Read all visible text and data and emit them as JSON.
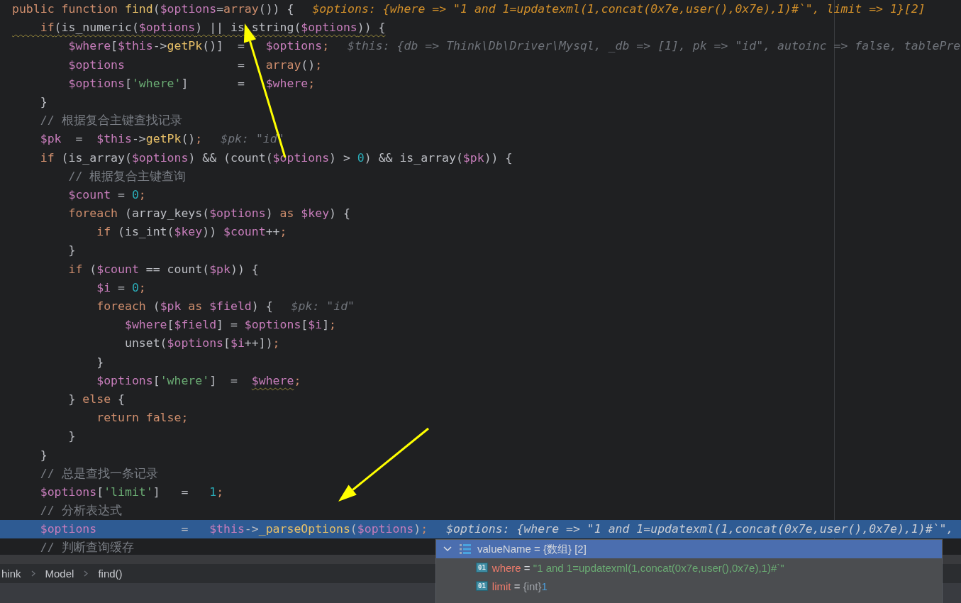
{
  "editor": {
    "lines": [
      {
        "selected": false,
        "tokens": [
          {
            "kind": "kw",
            "text": "public function "
          },
          {
            "kind": "fn",
            "text": "find"
          },
          {
            "kind": "plain",
            "text": "("
          },
          {
            "kind": "var",
            "text": "$options"
          },
          {
            "kind": "plain",
            "text": "="
          },
          {
            "kind": "kw",
            "text": "array"
          },
          {
            "kind": "plain",
            "text": "()) {"
          }
        ],
        "hint": {
          "kind": "changed",
          "text": "$options: {where => \"1 and 1=updatexml(1,concat(0x7e,user(),0x7e),1)#`\", limit => 1}[2]"
        }
      },
      {
        "selected": false,
        "tokens": [
          {
            "kind": "kw",
            "text": "    if",
            "squiggle": true
          },
          {
            "kind": "plain",
            "text": "(is_numeric(",
            "squiggle": true
          },
          {
            "kind": "var",
            "text": "$options",
            "squiggle": true
          },
          {
            "kind": "plain",
            "text": ") || is_string(",
            "squiggle": true
          },
          {
            "kind": "var",
            "text": "$options",
            "squiggle": true
          },
          {
            "kind": "plain",
            "text": ")) {",
            "squiggle": true
          }
        ]
      },
      {
        "selected": false,
        "tokens": [
          {
            "kind": "var",
            "text": "        $where"
          },
          {
            "kind": "plain",
            "text": "["
          },
          {
            "kind": "var",
            "text": "$this"
          },
          {
            "kind": "plain",
            "text": "->"
          },
          {
            "kind": "fn",
            "text": "getPk"
          },
          {
            "kind": "plain",
            "text": "()]  =   "
          },
          {
            "kind": "var",
            "text": "$options"
          },
          {
            "kind": "kw",
            "text": ";"
          }
        ],
        "hint": {
          "kind": "normal",
          "text": "$this: {db => Think\\Db\\Driver\\Mysql, _db => [1], pk => \"id\", autoinc => false, tablePre"
        }
      },
      {
        "selected": false,
        "tokens": [
          {
            "kind": "var",
            "text": "        $options"
          },
          {
            "kind": "plain",
            "text": "                =   "
          },
          {
            "kind": "kw",
            "text": "array"
          },
          {
            "kind": "plain",
            "text": "()"
          },
          {
            "kind": "kw",
            "text": ";"
          }
        ]
      },
      {
        "selected": false,
        "tokens": [
          {
            "kind": "var",
            "text": "        $options"
          },
          {
            "kind": "plain",
            "text": "["
          },
          {
            "kind": "str",
            "text": "'where'"
          },
          {
            "kind": "plain",
            "text": "]       =   "
          },
          {
            "kind": "var",
            "text": "$where"
          },
          {
            "kind": "kw",
            "text": ";"
          }
        ]
      },
      {
        "selected": false,
        "tokens": [
          {
            "kind": "plain",
            "text": "    }"
          }
        ]
      },
      {
        "selected": false,
        "tokens": [
          {
            "kind": "cmt",
            "text": "    // 根据复合主键查找记录"
          }
        ]
      },
      {
        "selected": false,
        "tokens": [
          {
            "kind": "var",
            "text": "    $pk"
          },
          {
            "kind": "plain",
            "text": "  =  "
          },
          {
            "kind": "var",
            "text": "$this"
          },
          {
            "kind": "plain",
            "text": "->"
          },
          {
            "kind": "fn",
            "text": "getPk"
          },
          {
            "kind": "plain",
            "text": "()"
          },
          {
            "kind": "kw",
            "text": ";"
          }
        ],
        "hint": {
          "kind": "normal",
          "text": "$pk: \"id\""
        }
      },
      {
        "selected": false,
        "tokens": [
          {
            "kind": "kw",
            "text": "    if"
          },
          {
            "kind": "plain",
            "text": " (is_array("
          },
          {
            "kind": "var",
            "text": "$options"
          },
          {
            "kind": "plain",
            "text": ") && (count("
          },
          {
            "kind": "var",
            "text": "$options"
          },
          {
            "kind": "plain",
            "text": ") > "
          },
          {
            "kind": "num",
            "text": "0"
          },
          {
            "kind": "plain",
            "text": ") && is_array("
          },
          {
            "kind": "var",
            "text": "$pk"
          },
          {
            "kind": "plain",
            "text": ")) {"
          }
        ]
      },
      {
        "selected": false,
        "tokens": [
          {
            "kind": "cmt",
            "text": "        // 根据复合主键查询"
          }
        ]
      },
      {
        "selected": false,
        "tokens": [
          {
            "kind": "var",
            "text": "        $count"
          },
          {
            "kind": "plain",
            "text": " = "
          },
          {
            "kind": "num",
            "text": "0"
          },
          {
            "kind": "kw",
            "text": ";"
          }
        ]
      },
      {
        "selected": false,
        "tokens": [
          {
            "kind": "kw",
            "text": "        foreach"
          },
          {
            "kind": "plain",
            "text": " (array_keys("
          },
          {
            "kind": "var",
            "text": "$options"
          },
          {
            "kind": "plain",
            "text": ") "
          },
          {
            "kind": "kw",
            "text": "as"
          },
          {
            "kind": "var",
            "text": " $key"
          },
          {
            "kind": "plain",
            "text": ") {"
          }
        ]
      },
      {
        "selected": false,
        "tokens": [
          {
            "kind": "kw",
            "text": "            if"
          },
          {
            "kind": "plain",
            "text": " (is_int("
          },
          {
            "kind": "var",
            "text": "$key"
          },
          {
            "kind": "plain",
            "text": ")) "
          },
          {
            "kind": "var",
            "text": "$count"
          },
          {
            "kind": "plain",
            "text": "++"
          },
          {
            "kind": "kw",
            "text": ";"
          }
        ]
      },
      {
        "selected": false,
        "tokens": [
          {
            "kind": "plain",
            "text": "        }"
          }
        ]
      },
      {
        "selected": false,
        "tokens": [
          {
            "kind": "kw",
            "text": "        if"
          },
          {
            "kind": "plain",
            "text": " ("
          },
          {
            "kind": "var",
            "text": "$count"
          },
          {
            "kind": "plain",
            "text": " == count("
          },
          {
            "kind": "var",
            "text": "$pk"
          },
          {
            "kind": "plain",
            "text": ")) {"
          }
        ]
      },
      {
        "selected": false,
        "tokens": [
          {
            "kind": "var",
            "text": "            $i"
          },
          {
            "kind": "plain",
            "text": " = "
          },
          {
            "kind": "num",
            "text": "0"
          },
          {
            "kind": "kw",
            "text": ";"
          }
        ]
      },
      {
        "selected": false,
        "tokens": [
          {
            "kind": "kw",
            "text": "            foreach"
          },
          {
            "kind": "plain",
            "text": " ("
          },
          {
            "kind": "var",
            "text": "$pk"
          },
          {
            "kind": "kw",
            "text": " as"
          },
          {
            "kind": "var",
            "text": " $field"
          },
          {
            "kind": "plain",
            "text": ") {"
          }
        ],
        "hint": {
          "kind": "normal",
          "text": "$pk: \"id\""
        }
      },
      {
        "selected": false,
        "tokens": [
          {
            "kind": "var",
            "text": "                $where"
          },
          {
            "kind": "plain",
            "text": "["
          },
          {
            "kind": "var",
            "text": "$field"
          },
          {
            "kind": "plain",
            "text": "] = "
          },
          {
            "kind": "var",
            "text": "$options"
          },
          {
            "kind": "plain",
            "text": "["
          },
          {
            "kind": "var",
            "text": "$i"
          },
          {
            "kind": "plain",
            "text": "]"
          },
          {
            "kind": "kw",
            "text": ";"
          }
        ]
      },
      {
        "selected": false,
        "tokens": [
          {
            "kind": "plain",
            "text": "                unset("
          },
          {
            "kind": "var",
            "text": "$options"
          },
          {
            "kind": "plain",
            "text": "["
          },
          {
            "kind": "var",
            "text": "$i"
          },
          {
            "kind": "plain",
            "text": "++])"
          },
          {
            "kind": "kw",
            "text": ";"
          }
        ]
      },
      {
        "selected": false,
        "tokens": [
          {
            "kind": "plain",
            "text": "            }"
          }
        ]
      },
      {
        "selected": false,
        "tokens": [
          {
            "kind": "var",
            "text": "            $options"
          },
          {
            "kind": "plain",
            "text": "["
          },
          {
            "kind": "str",
            "text": "'where'"
          },
          {
            "kind": "plain",
            "text": "]  =  "
          },
          {
            "kind": "var",
            "text": "$where",
            "squiggle": true
          },
          {
            "kind": "kw",
            "text": ";"
          }
        ]
      },
      {
        "selected": false,
        "tokens": [
          {
            "kind": "plain",
            "text": "        } "
          },
          {
            "kind": "kw",
            "text": "else"
          },
          {
            "kind": "plain",
            "text": " {"
          }
        ]
      },
      {
        "selected": false,
        "tokens": [
          {
            "kind": "kw",
            "text": "            return false;"
          }
        ]
      },
      {
        "selected": false,
        "tokens": [
          {
            "kind": "plain",
            "text": "        }"
          }
        ]
      },
      {
        "selected": false,
        "tokens": [
          {
            "kind": "plain",
            "text": "    }"
          }
        ]
      },
      {
        "selected": false,
        "tokens": [
          {
            "kind": "cmt",
            "text": "    // 总是查找一条记录"
          }
        ]
      },
      {
        "selected": false,
        "tokens": [
          {
            "kind": "var",
            "text": "    $options"
          },
          {
            "kind": "plain",
            "text": "["
          },
          {
            "kind": "str",
            "text": "'limit'"
          },
          {
            "kind": "plain",
            "text": "]   =   "
          },
          {
            "kind": "num",
            "text": "1"
          },
          {
            "kind": "kw",
            "text": ";"
          }
        ]
      },
      {
        "selected": false,
        "tokens": [
          {
            "kind": "cmt",
            "text": "    // 分析表达式"
          }
        ]
      },
      {
        "selected": true,
        "tokens": [
          {
            "kind": "var",
            "text": "    $options"
          },
          {
            "kind": "plain",
            "text": "            =   "
          },
          {
            "kind": "var",
            "text": "$this"
          },
          {
            "kind": "plain",
            "text": "->"
          },
          {
            "kind": "fn",
            "text": "_parseOptions"
          },
          {
            "kind": "plain",
            "text": "("
          },
          {
            "kind": "var",
            "text": "$options"
          },
          {
            "kind": "plain",
            "text": ")"
          },
          {
            "kind": "kw",
            "text": ";"
          }
        ],
        "hint": {
          "kind": "normal",
          "text": "$options: {where => \"1 and 1=updatexml(1,concat(0x7e,user(),0x7e),1)#`\","
        }
      },
      {
        "selected": false,
        "tokens": [
          {
            "kind": "cmt",
            "text": "    // 判断查询缓存"
          }
        ]
      }
    ]
  },
  "breadcrumb": [
    "hink",
    "Model",
    "find()"
  ],
  "value_popup": {
    "expanded": true,
    "name": "valueName",
    "operator": "=",
    "type": "{数组}",
    "count": "[2]",
    "items": [
      {
        "badge": "01",
        "name": "where",
        "operator": "=",
        "kind": "string",
        "value": "\"1 and 1=updatexml(1,concat(0x7e,user(),0x7e),1)#`\""
      },
      {
        "badge": "01",
        "name": "limit",
        "operator": "=",
        "type": "{int}",
        "kind": "number",
        "value": "1"
      }
    ]
  }
}
